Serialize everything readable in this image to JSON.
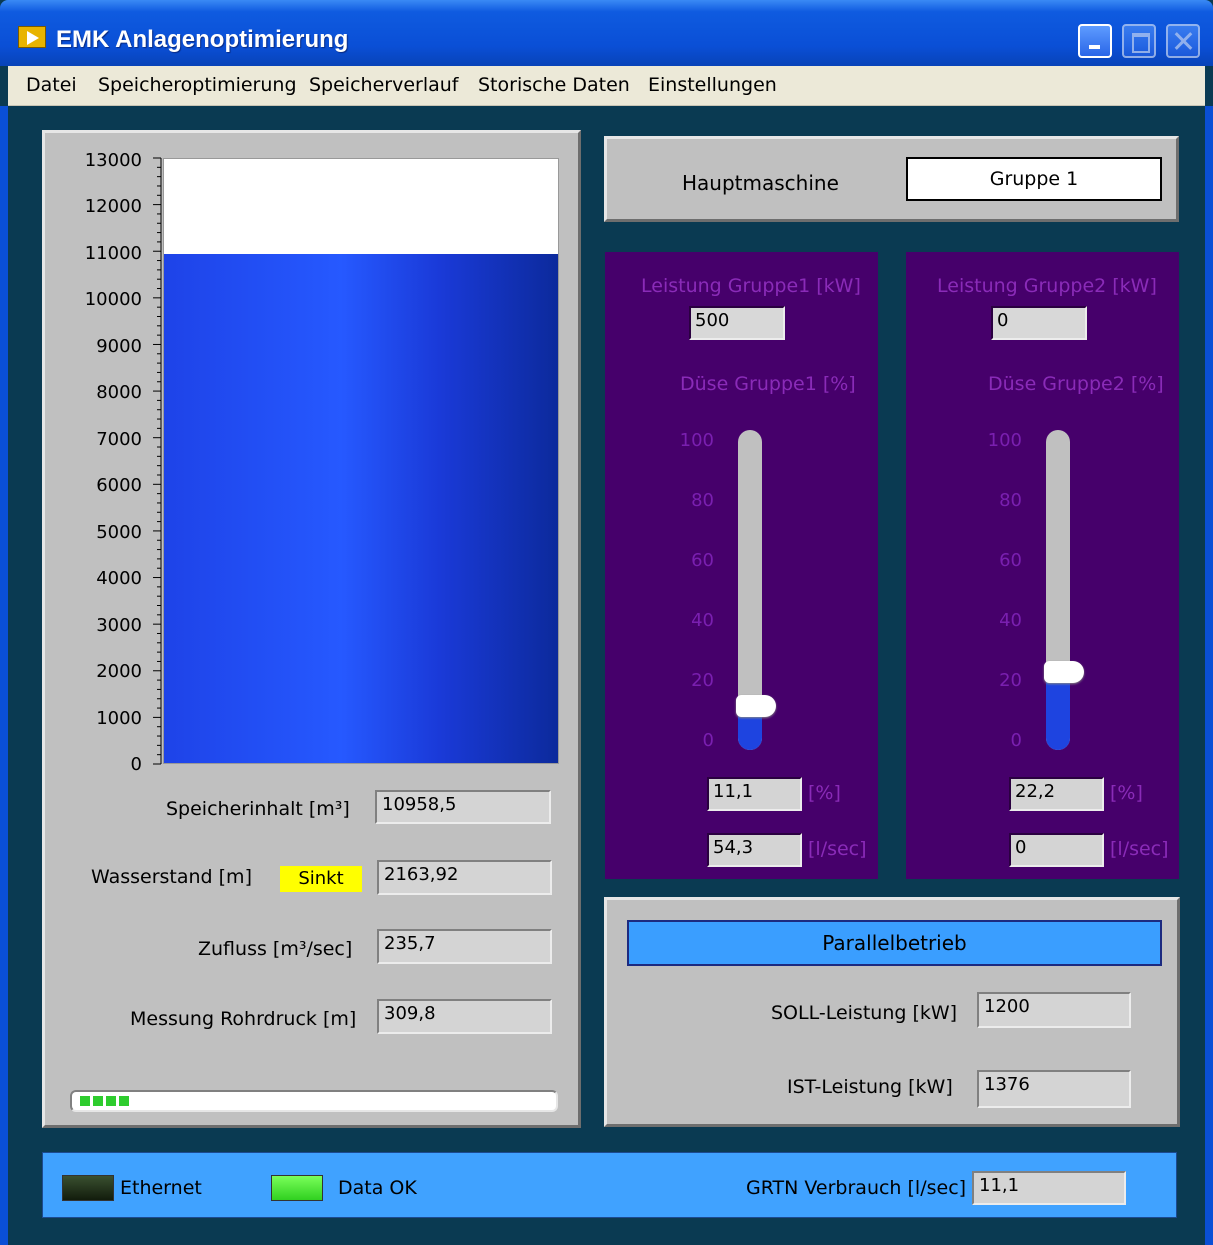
{
  "window": {
    "title": "EMK Anlagenoptimierung"
  },
  "menu": [
    "Datei",
    "Speicheroptimierung",
    "Speicherverlauf",
    "Storische Daten",
    "Einstellungen"
  ],
  "storage": {
    "gauge_ticks": [
      "13000",
      "12000",
      "11000",
      "10000",
      "9000",
      "8000",
      "7000",
      "6000",
      "5000",
      "4000",
      "3000",
      "2000",
      "1000",
      "0"
    ],
    "gauge_value": 10958.5,
    "gauge_max": 13000,
    "speicherinhalt_label": "Speicherinhalt  [m³]",
    "speicherinhalt_value": "10958,5",
    "wasserstand_label": "Wasserstand [m]",
    "wasserstand_status": "Sinkt",
    "wasserstand_value": "2163,92",
    "zufluss_label": "Zufluss [m³/sec]",
    "zufluss_value": "235,7",
    "rohrdruck_label": "Messung Rohrdruck [m]",
    "rohrdruck_value": "309,8",
    "progress_blocks": 4
  },
  "hauptmaschine": {
    "label": "Hauptmaschine",
    "value": "Gruppe 1"
  },
  "gruppe1": {
    "leistung_label": "Leistung Gruppe1 [kW]",
    "leistung_value": "500",
    "duese_label": "Düse Gruppe1 [%]",
    "duese_value": 11.1,
    "ticks": [
      "100",
      "80",
      "60",
      "40",
      "20",
      "0"
    ],
    "prozent_value": "11,1",
    "prozent_unit": "[%]",
    "fluss_value": "54,3",
    "fluss_unit": "[l/sec]"
  },
  "gruppe2": {
    "leistung_label": "Leistung Gruppe2 [kW]",
    "leistung_value": "0",
    "duese_label": "Düse Gruppe2 [%]",
    "duese_value": 22.2,
    "ticks": [
      "100",
      "80",
      "60",
      "40",
      "20",
      "0"
    ],
    "prozent_value": "22,2",
    "prozent_unit": "[%]",
    "fluss_value": "0",
    "fluss_unit": "[l/sec]"
  },
  "parallel": {
    "button_label": "Parallelbetrieb",
    "soll_label": "SOLL-Leistung [kW]",
    "soll_value": "1200",
    "ist_label": "IST-Leistung [kW]",
    "ist_value": "1376"
  },
  "status": {
    "ethernet_label": "Ethernet",
    "data_ok_label": "Data OK",
    "grtn_label": "GRTN Verbrauch [l/sec]",
    "grtn_value": "11,1"
  }
}
